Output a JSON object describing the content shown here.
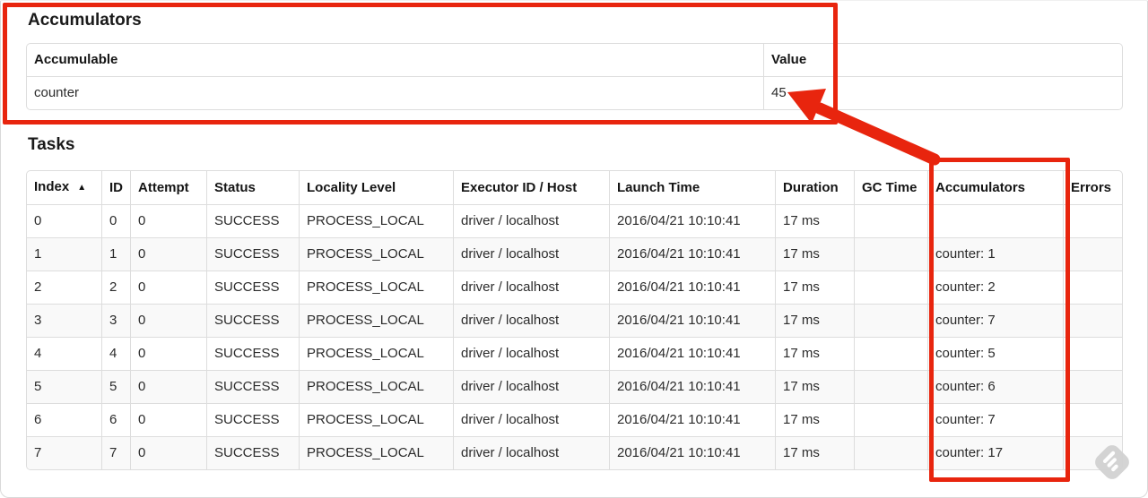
{
  "accumulators_section": {
    "title": "Accumulators",
    "headers": {
      "accumulable": "Accumulable",
      "value": "Value"
    },
    "rows": [
      {
        "accumulable": "counter",
        "value": "45"
      }
    ]
  },
  "tasks_section": {
    "title": "Tasks",
    "headers": {
      "index": "Index",
      "sort_icon": "▲",
      "id": "ID",
      "attempt": "Attempt",
      "status": "Status",
      "locality": "Locality Level",
      "executor": "Executor ID / Host",
      "launch": "Launch Time",
      "duration": "Duration",
      "gc": "GC Time",
      "accumulators": "Accumulators",
      "errors": "Errors"
    },
    "rows": [
      {
        "index": "0",
        "id": "0",
        "attempt": "0",
        "status": "SUCCESS",
        "locality": "PROCESS_LOCAL",
        "executor": "driver / localhost",
        "launch": "2016/04/21 10:10:41",
        "duration": "17 ms",
        "gc": "",
        "accumulators": "",
        "errors": ""
      },
      {
        "index": "1",
        "id": "1",
        "attempt": "0",
        "status": "SUCCESS",
        "locality": "PROCESS_LOCAL",
        "executor": "driver / localhost",
        "launch": "2016/04/21 10:10:41",
        "duration": "17 ms",
        "gc": "",
        "accumulators": "counter: 1",
        "errors": ""
      },
      {
        "index": "2",
        "id": "2",
        "attempt": "0",
        "status": "SUCCESS",
        "locality": "PROCESS_LOCAL",
        "executor": "driver / localhost",
        "launch": "2016/04/21 10:10:41",
        "duration": "17 ms",
        "gc": "",
        "accumulators": "counter: 2",
        "errors": ""
      },
      {
        "index": "3",
        "id": "3",
        "attempt": "0",
        "status": "SUCCESS",
        "locality": "PROCESS_LOCAL",
        "executor": "driver / localhost",
        "launch": "2016/04/21 10:10:41",
        "duration": "17 ms",
        "gc": "",
        "accumulators": "counter: 7",
        "errors": ""
      },
      {
        "index": "4",
        "id": "4",
        "attempt": "0",
        "status": "SUCCESS",
        "locality": "PROCESS_LOCAL",
        "executor": "driver / localhost",
        "launch": "2016/04/21 10:10:41",
        "duration": "17 ms",
        "gc": "",
        "accumulators": "counter: 5",
        "errors": ""
      },
      {
        "index": "5",
        "id": "5",
        "attempt": "0",
        "status": "SUCCESS",
        "locality": "PROCESS_LOCAL",
        "executor": "driver / localhost",
        "launch": "2016/04/21 10:10:41",
        "duration": "17 ms",
        "gc": "",
        "accumulators": "counter: 6",
        "errors": ""
      },
      {
        "index": "6",
        "id": "6",
        "attempt": "0",
        "status": "SUCCESS",
        "locality": "PROCESS_LOCAL",
        "executor": "driver / localhost",
        "launch": "2016/04/21 10:10:41",
        "duration": "17 ms",
        "gc": "",
        "accumulators": "counter: 7",
        "errors": ""
      },
      {
        "index": "7",
        "id": "7",
        "attempt": "0",
        "status": "SUCCESS",
        "locality": "PROCESS_LOCAL",
        "executor": "driver / localhost",
        "launch": "2016/04/21 10:10:41",
        "duration": "17 ms",
        "gc": "",
        "accumulators": "counter: 17",
        "errors": ""
      }
    ]
  },
  "annotations": {
    "color": "#e8250e",
    "boxes": [
      "accumulators-section",
      "tasks-accumulators-column"
    ],
    "arrow_points_at": "45"
  },
  "watermark_icon": "feedly-diamond-icon"
}
